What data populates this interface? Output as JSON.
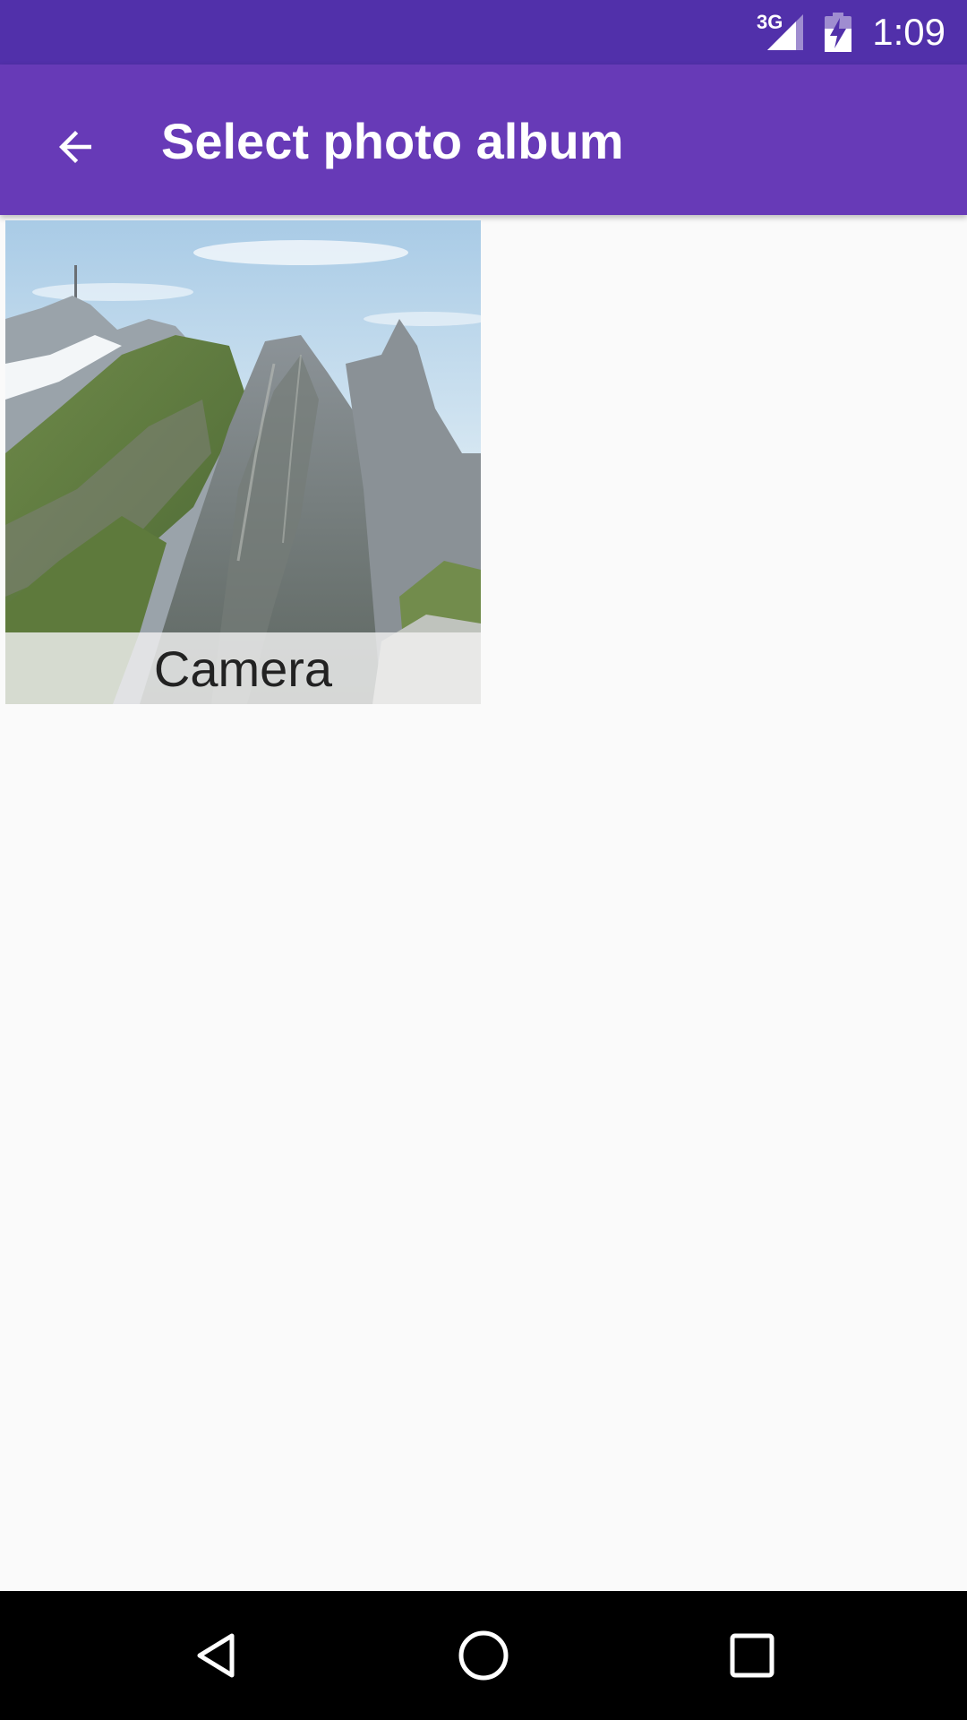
{
  "status_bar": {
    "network_type": "3G",
    "time": "1:09",
    "icons": [
      "signal-icon",
      "battery-charging-icon"
    ]
  },
  "app_bar": {
    "title": "Select photo album",
    "back_icon": "arrow-back-icon"
  },
  "albums": [
    {
      "name": "Camera",
      "thumbnail": "mountain-landscape"
    }
  ],
  "nav_bar": {
    "icons": [
      "nav-back-icon",
      "nav-home-icon",
      "nav-recents-icon"
    ]
  },
  "colors": {
    "status_bar": "#5130aa",
    "app_bar": "#673ab7",
    "background": "#fafafa",
    "nav_bar": "#000000"
  }
}
